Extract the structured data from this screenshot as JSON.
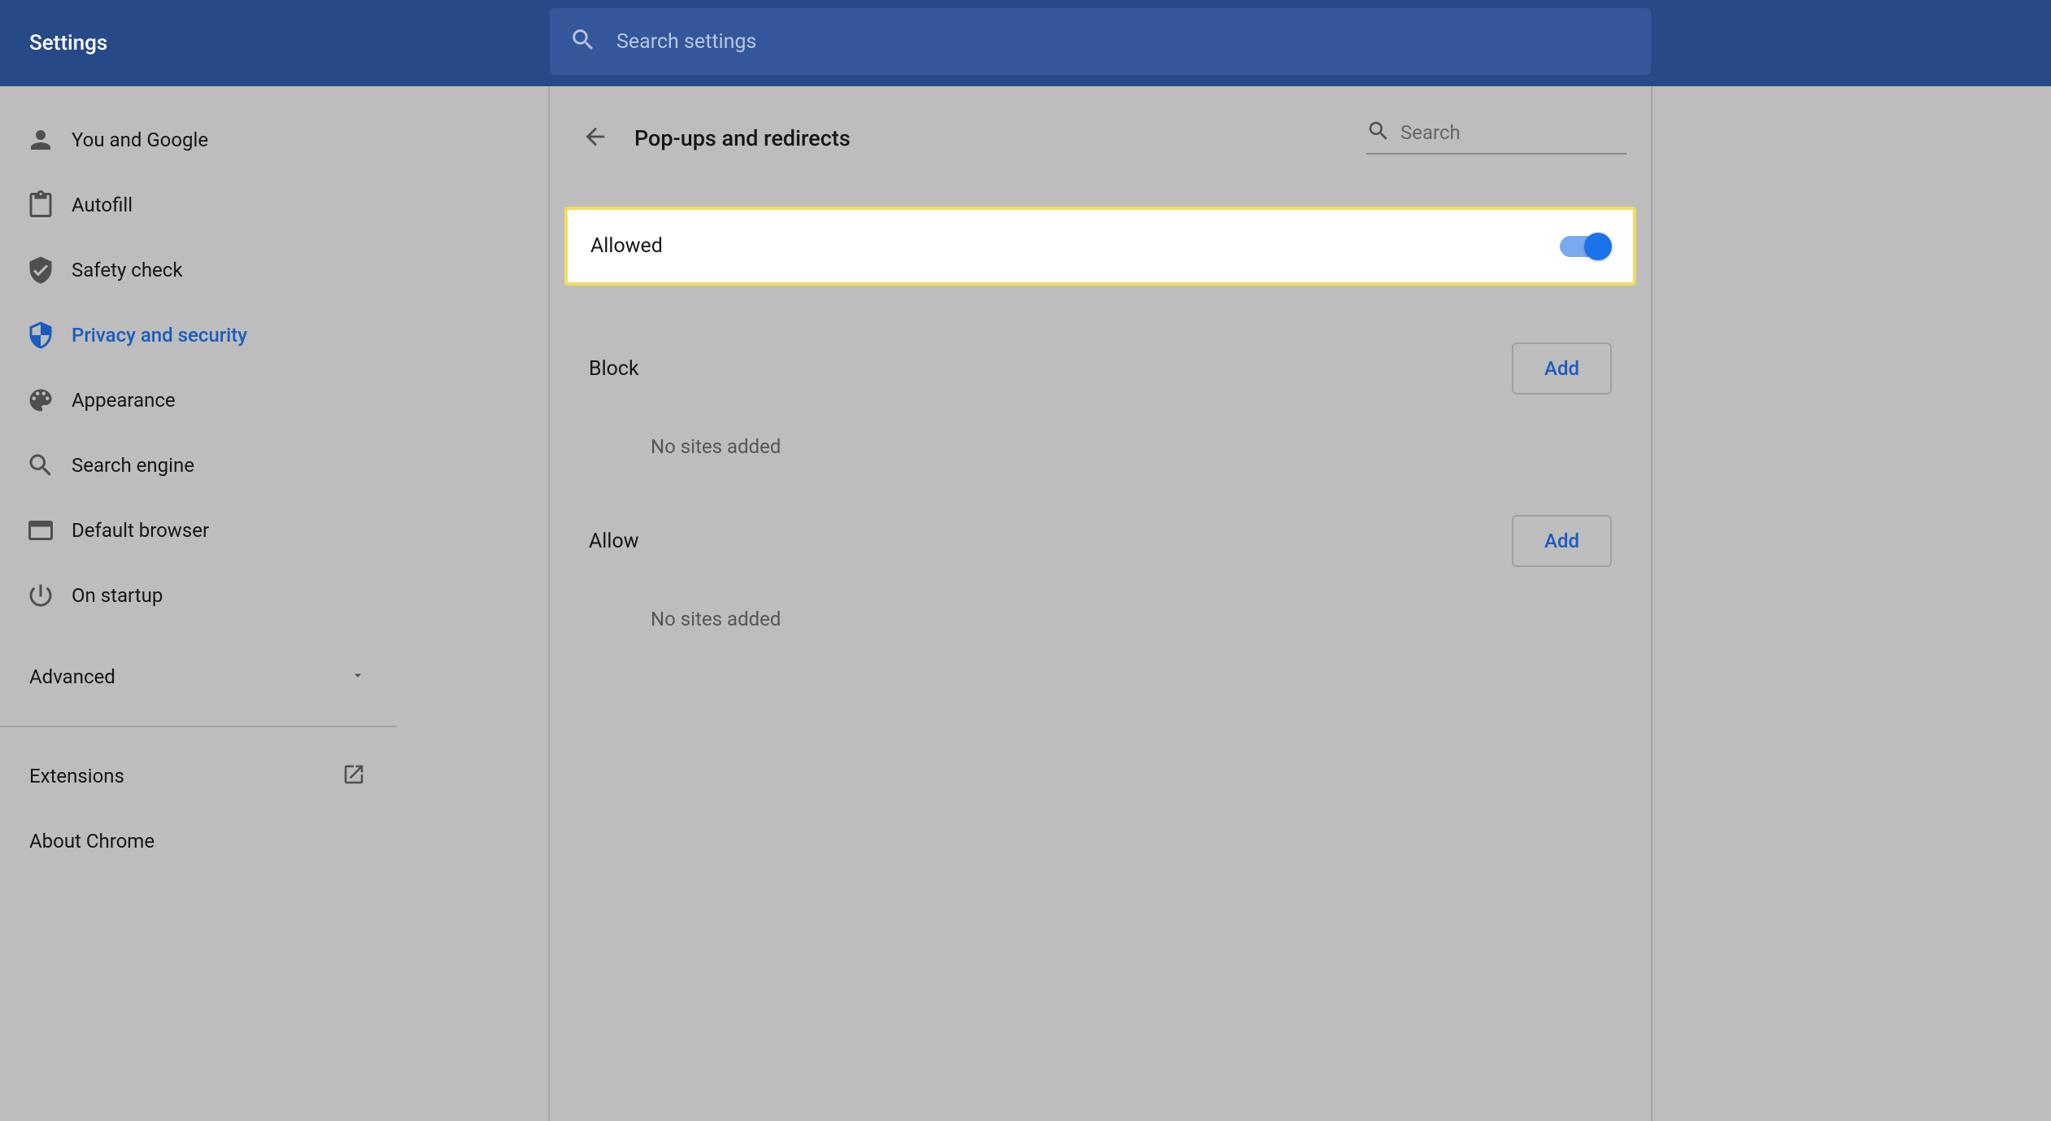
{
  "app_title": "Settings",
  "search_placeholder": "Search settings",
  "sidebar": {
    "items": [
      {
        "label": "You and Google",
        "icon": "person"
      },
      {
        "label": "Autofill",
        "icon": "clipboard"
      },
      {
        "label": "Safety check",
        "icon": "shield-check"
      },
      {
        "label": "Privacy and security",
        "icon": "shield",
        "active": true
      },
      {
        "label": "Appearance",
        "icon": "palette"
      },
      {
        "label": "Search engine",
        "icon": "search"
      },
      {
        "label": "Default browser",
        "icon": "browser"
      },
      {
        "label": "On startup",
        "icon": "power"
      }
    ],
    "advanced_label": "Advanced",
    "extensions_label": "Extensions",
    "about_label": "About Chrome"
  },
  "page": {
    "title": "Pop-ups and redirects",
    "search_placeholder": "Search",
    "allowed": {
      "label": "Allowed",
      "enabled": true
    },
    "block": {
      "heading": "Block",
      "add_button": "Add",
      "empty_message": "No sites added"
    },
    "allow": {
      "heading": "Allow",
      "add_button": "Add",
      "empty_message": "No sites added"
    }
  }
}
